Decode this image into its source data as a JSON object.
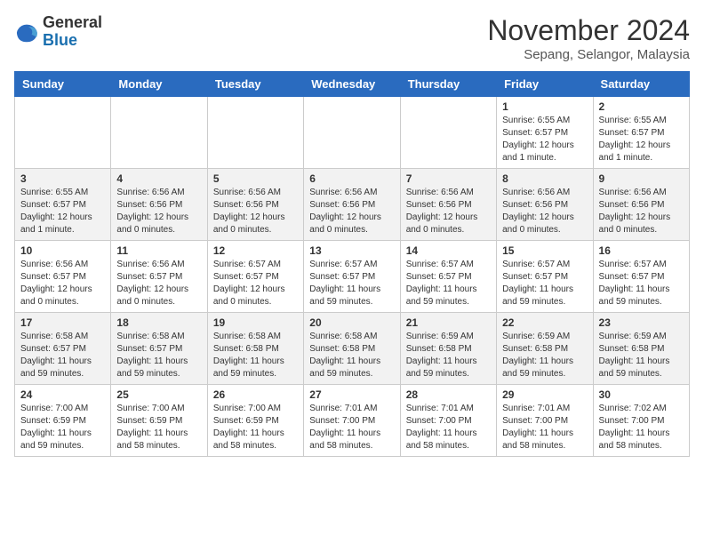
{
  "header": {
    "logo_general": "General",
    "logo_blue": "Blue",
    "month_year": "November 2024",
    "location": "Sepang, Selangor, Malaysia"
  },
  "weekdays": [
    "Sunday",
    "Monday",
    "Tuesday",
    "Wednesday",
    "Thursday",
    "Friday",
    "Saturday"
  ],
  "weeks": [
    [
      {
        "day": "",
        "info": ""
      },
      {
        "day": "",
        "info": ""
      },
      {
        "day": "",
        "info": ""
      },
      {
        "day": "",
        "info": ""
      },
      {
        "day": "",
        "info": ""
      },
      {
        "day": "1",
        "info": "Sunrise: 6:55 AM\nSunset: 6:57 PM\nDaylight: 12 hours and 1 minute."
      },
      {
        "day": "2",
        "info": "Sunrise: 6:55 AM\nSunset: 6:57 PM\nDaylight: 12 hours and 1 minute."
      }
    ],
    [
      {
        "day": "3",
        "info": "Sunrise: 6:55 AM\nSunset: 6:57 PM\nDaylight: 12 hours and 1 minute."
      },
      {
        "day": "4",
        "info": "Sunrise: 6:56 AM\nSunset: 6:56 PM\nDaylight: 12 hours and 0 minutes."
      },
      {
        "day": "5",
        "info": "Sunrise: 6:56 AM\nSunset: 6:56 PM\nDaylight: 12 hours and 0 minutes."
      },
      {
        "day": "6",
        "info": "Sunrise: 6:56 AM\nSunset: 6:56 PM\nDaylight: 12 hours and 0 minutes."
      },
      {
        "day": "7",
        "info": "Sunrise: 6:56 AM\nSunset: 6:56 PM\nDaylight: 12 hours and 0 minutes."
      },
      {
        "day": "8",
        "info": "Sunrise: 6:56 AM\nSunset: 6:56 PM\nDaylight: 12 hours and 0 minutes."
      },
      {
        "day": "9",
        "info": "Sunrise: 6:56 AM\nSunset: 6:56 PM\nDaylight: 12 hours and 0 minutes."
      }
    ],
    [
      {
        "day": "10",
        "info": "Sunrise: 6:56 AM\nSunset: 6:57 PM\nDaylight: 12 hours and 0 minutes."
      },
      {
        "day": "11",
        "info": "Sunrise: 6:56 AM\nSunset: 6:57 PM\nDaylight: 12 hours and 0 minutes."
      },
      {
        "day": "12",
        "info": "Sunrise: 6:57 AM\nSunset: 6:57 PM\nDaylight: 12 hours and 0 minutes."
      },
      {
        "day": "13",
        "info": "Sunrise: 6:57 AM\nSunset: 6:57 PM\nDaylight: 11 hours and 59 minutes."
      },
      {
        "day": "14",
        "info": "Sunrise: 6:57 AM\nSunset: 6:57 PM\nDaylight: 11 hours and 59 minutes."
      },
      {
        "day": "15",
        "info": "Sunrise: 6:57 AM\nSunset: 6:57 PM\nDaylight: 11 hours and 59 minutes."
      },
      {
        "day": "16",
        "info": "Sunrise: 6:57 AM\nSunset: 6:57 PM\nDaylight: 11 hours and 59 minutes."
      }
    ],
    [
      {
        "day": "17",
        "info": "Sunrise: 6:58 AM\nSunset: 6:57 PM\nDaylight: 11 hours and 59 minutes."
      },
      {
        "day": "18",
        "info": "Sunrise: 6:58 AM\nSunset: 6:57 PM\nDaylight: 11 hours and 59 minutes."
      },
      {
        "day": "19",
        "info": "Sunrise: 6:58 AM\nSunset: 6:58 PM\nDaylight: 11 hours and 59 minutes."
      },
      {
        "day": "20",
        "info": "Sunrise: 6:58 AM\nSunset: 6:58 PM\nDaylight: 11 hours and 59 minutes."
      },
      {
        "day": "21",
        "info": "Sunrise: 6:59 AM\nSunset: 6:58 PM\nDaylight: 11 hours and 59 minutes."
      },
      {
        "day": "22",
        "info": "Sunrise: 6:59 AM\nSunset: 6:58 PM\nDaylight: 11 hours and 59 minutes."
      },
      {
        "day": "23",
        "info": "Sunrise: 6:59 AM\nSunset: 6:58 PM\nDaylight: 11 hours and 59 minutes."
      }
    ],
    [
      {
        "day": "24",
        "info": "Sunrise: 7:00 AM\nSunset: 6:59 PM\nDaylight: 11 hours and 59 minutes."
      },
      {
        "day": "25",
        "info": "Sunrise: 7:00 AM\nSunset: 6:59 PM\nDaylight: 11 hours and 58 minutes."
      },
      {
        "day": "26",
        "info": "Sunrise: 7:00 AM\nSunset: 6:59 PM\nDaylight: 11 hours and 58 minutes."
      },
      {
        "day": "27",
        "info": "Sunrise: 7:01 AM\nSunset: 7:00 PM\nDaylight: 11 hours and 58 minutes."
      },
      {
        "day": "28",
        "info": "Sunrise: 7:01 AM\nSunset: 7:00 PM\nDaylight: 11 hours and 58 minutes."
      },
      {
        "day": "29",
        "info": "Sunrise: 7:01 AM\nSunset: 7:00 PM\nDaylight: 11 hours and 58 minutes."
      },
      {
        "day": "30",
        "info": "Sunrise: 7:02 AM\nSunset: 7:00 PM\nDaylight: 11 hours and 58 minutes."
      }
    ]
  ]
}
